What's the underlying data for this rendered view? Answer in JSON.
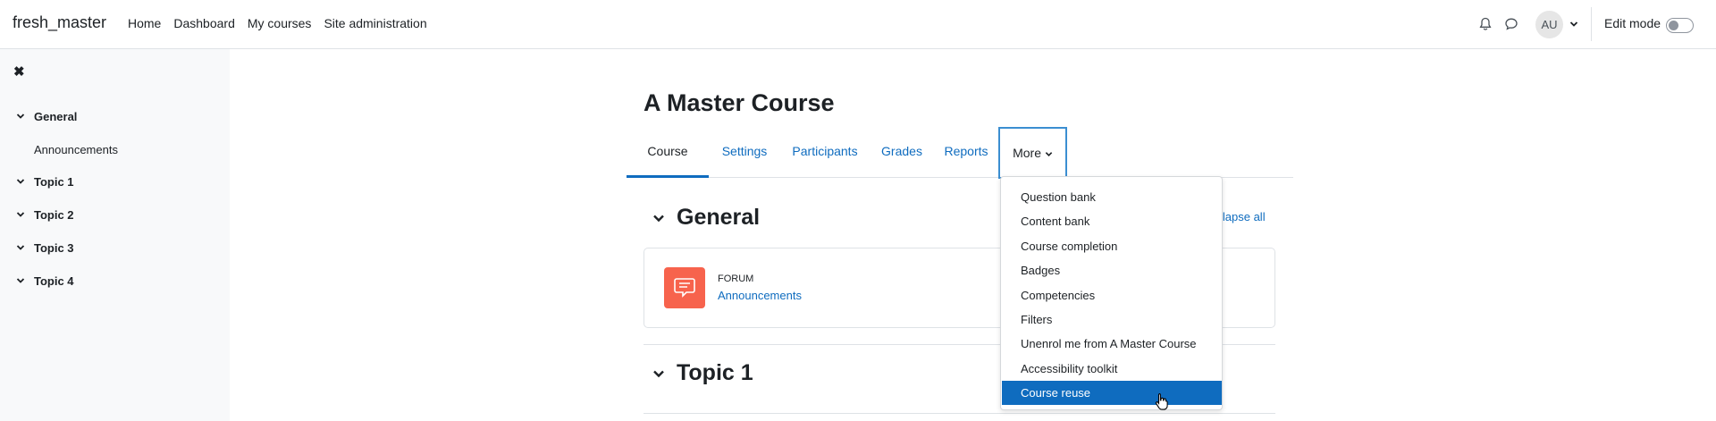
{
  "navbar": {
    "brand": "fresh_master",
    "links": [
      "Home",
      "Dashboard",
      "My courses",
      "Site administration"
    ],
    "avatar_initials": "AU",
    "edit_mode_label": "Edit mode"
  },
  "drawer": {
    "close_glyph": "✖",
    "items": [
      {
        "label": "General",
        "type": "section"
      },
      {
        "label": "Announcements",
        "type": "activity"
      },
      {
        "label": "Topic 1",
        "type": "section"
      },
      {
        "label": "Topic 2",
        "type": "section"
      },
      {
        "label": "Topic 3",
        "type": "section"
      },
      {
        "label": "Topic 4",
        "type": "section"
      }
    ]
  },
  "course": {
    "title": "A Master Course",
    "tabs": [
      "Course",
      "Settings",
      "Participants",
      "Grades",
      "Reports",
      "More"
    ],
    "active_tab": "Course",
    "collapse_all": "llapse all",
    "sections": [
      {
        "title": "General"
      },
      {
        "title": "Topic 1"
      }
    ],
    "activity": {
      "type_label": "FORUM",
      "name": "Announcements"
    }
  },
  "more_menu": {
    "items": [
      "Question bank",
      "Content bank",
      "Course completion",
      "Badges",
      "Competencies",
      "Filters",
      "Unenrol me from A Master Course",
      "Accessibility toolkit",
      "Course reuse"
    ],
    "highlighted": "Course reuse"
  },
  "colors": {
    "accent": "#0f6cbf",
    "forum_icon": "#f7634d",
    "drawer_bg": "#f8f9fa"
  }
}
